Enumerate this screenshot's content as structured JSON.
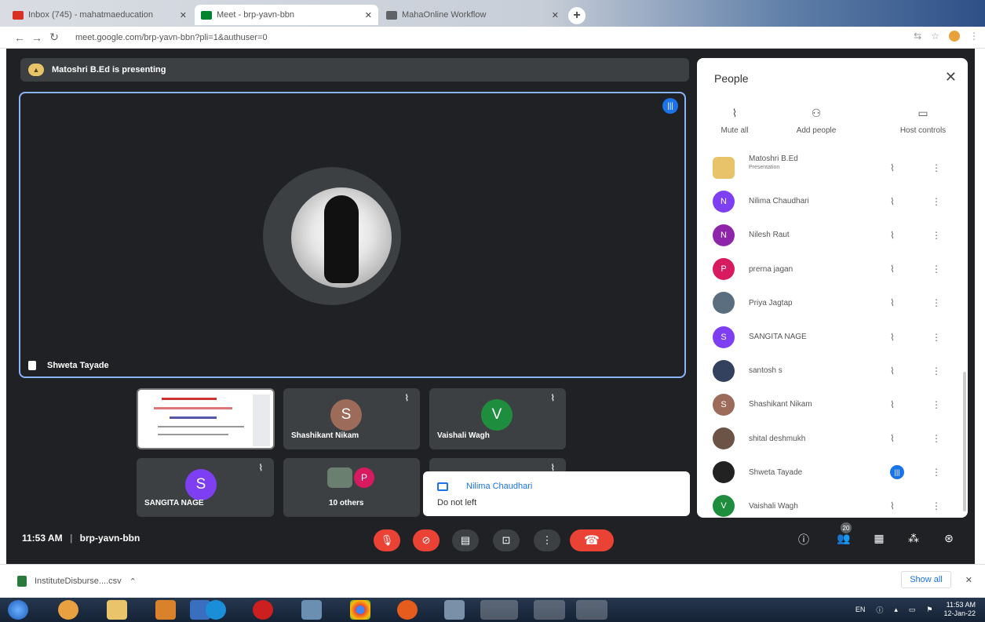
{
  "browser": {
    "tabs": [
      {
        "title": "Inbox (745) - mahatmaeducation",
        "favicon_color": "#d93025"
      },
      {
        "title": "Meet - brp-yavn-bbn",
        "favicon_color": "#00832d"
      },
      {
        "title": "MahaOnline Workflow",
        "favicon_color": "#5f6368"
      }
    ],
    "new_tab_label": "+",
    "url": "meet.google.com/brp-yavn-bbn?pli=1&authuser=0"
  },
  "meet": {
    "presenting_banner": "Matoshri B.Ed is presenting",
    "main_speaker": "Shweta Tayade",
    "tiles": [
      {
        "name": "Shashikant Nikam",
        "initial": "S",
        "color": "#9c6b5a"
      },
      {
        "name": "Vaishali Wagh",
        "initial": "V",
        "color": "#1e8e3e"
      },
      {
        "name": "SANGITA NAGE",
        "initial": "S",
        "color": "#7e3ff2"
      },
      {
        "name": "10 others",
        "initial": "P",
        "color": "#d81b60"
      }
    ],
    "toast": {
      "name": "Nilima Chaudhari",
      "message": "Do not left"
    },
    "meeting_time": "11:53 AM",
    "meeting_code": "brp-yavn-bbn",
    "participant_count": "20"
  },
  "people_panel": {
    "title": "People",
    "actions": [
      "Mute all",
      "Add people",
      "Host controls"
    ],
    "participants": [
      {
        "name": "Matoshri B.Ed",
        "subtitle": "Presentation",
        "initial": "",
        "color": "#e8c36a",
        "speaking": false
      },
      {
        "name": "Nilima Chaudhari",
        "initial": "N",
        "color": "#7e3ff2",
        "speaking": false
      },
      {
        "name": "Nilesh Raut",
        "initial": "N",
        "color": "#8e24aa",
        "speaking": false
      },
      {
        "name": "prerna jagan",
        "initial": "P",
        "color": "#d81b60",
        "speaking": false
      },
      {
        "name": "Priya Jagtap",
        "initial": "",
        "color": "#5a6e7f",
        "speaking": false
      },
      {
        "name": "SANGITA NAGE",
        "initial": "S",
        "color": "#7e3ff2",
        "speaking": false
      },
      {
        "name": "santosh s",
        "initial": "",
        "color": "#33415e",
        "speaking": false
      },
      {
        "name": "Shashikant Nikam",
        "initial": "S",
        "color": "#9c6b5a",
        "speaking": false
      },
      {
        "name": "shital deshmukh",
        "initial": "",
        "color": "#6b5345",
        "speaking": false
      },
      {
        "name": "Shweta Tayade",
        "initial": "",
        "color": "#222222",
        "speaking": true
      },
      {
        "name": "Vaishali Wagh",
        "initial": "V",
        "color": "#1e8e3e",
        "speaking": false
      }
    ]
  },
  "downloads": {
    "file": "InstituteDisburse....csv",
    "show_all": "Show all"
  },
  "taskbar": {
    "time": "11:53 AM",
    "date": "12-Jan-22",
    "lang": "EN"
  }
}
